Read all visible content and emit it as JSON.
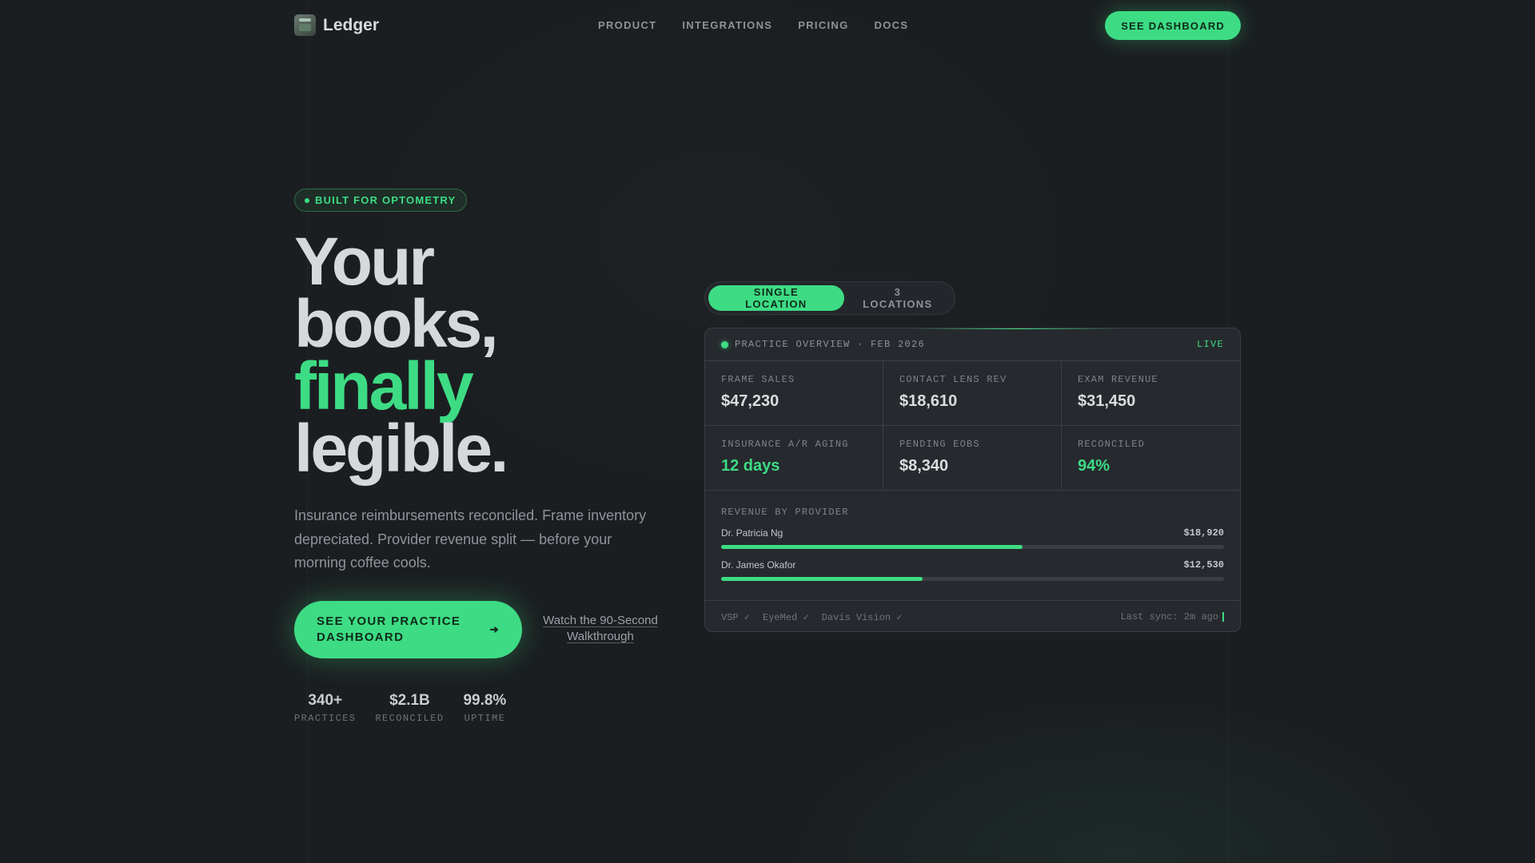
{
  "nav": {
    "brand": "Ledger",
    "links": [
      "PRODUCT",
      "INTEGRATIONS",
      "PRICING",
      "DOCS"
    ],
    "cta": "SEE DASHBOARD"
  },
  "hero": {
    "badge": "BUILT FOR OPTOMETRY",
    "headline": [
      "Your",
      "books,",
      "finally",
      "legible."
    ],
    "subcopy": "Insurance reimbursements reconciled. Frame inventory depreciated. Provider revenue split — before your morning coffee cools.",
    "cta_primary": "SEE YOUR PRACTICE DASHBOARD",
    "cta_secondary": "Watch the 90-Second Walkthrough",
    "stats": [
      {
        "value": "340+",
        "label": "PRACTICES"
      },
      {
        "value": "$2.1B",
        "label": "RECONCILED"
      },
      {
        "value": "99.8%",
        "label": "UPTIME"
      }
    ]
  },
  "toggle": {
    "options": [
      "SINGLE LOCATION",
      "3 LOCATIONS"
    ],
    "selected": "SINGLE LOCATION"
  },
  "panel": {
    "title": "PRACTICE OVERVIEW · FEB 2026",
    "status": "LIVE",
    "metrics": [
      {
        "label": "FRAME SALES",
        "value": "$47,230"
      },
      {
        "label": "CONTACT LENS REV",
        "value": "$18,610"
      },
      {
        "label": "EXAM REVENUE",
        "value": "$31,450"
      },
      {
        "label": "INSURANCE A/R AGING",
        "value": "12 days"
      },
      {
        "label": "PENDING EOBS",
        "value": "$8,340"
      },
      {
        "label": "RECONCILED",
        "value": "94%"
      }
    ],
    "revenue_title": "REVENUE BY PROVIDER",
    "providers": [
      {
        "name": "Dr. Patricia Ng",
        "amount": "$18,920",
        "share": 0.6
      },
      {
        "name": "Dr. James Okafor",
        "amount": "$12,530",
        "share": 0.4
      }
    ],
    "integrations": [
      "VSP ✓",
      "EyeMed ✓",
      "Davis Vision ✓"
    ],
    "last_sync": "Last sync: 2m ago"
  },
  "colors": {
    "accent": "#3ddc84",
    "background": "#1b1e21",
    "panel": "#262a2e"
  },
  "icons": {
    "logo": "ledger-logo-icon",
    "arrow": "arrow-right-icon",
    "live": "live-dot-icon"
  }
}
